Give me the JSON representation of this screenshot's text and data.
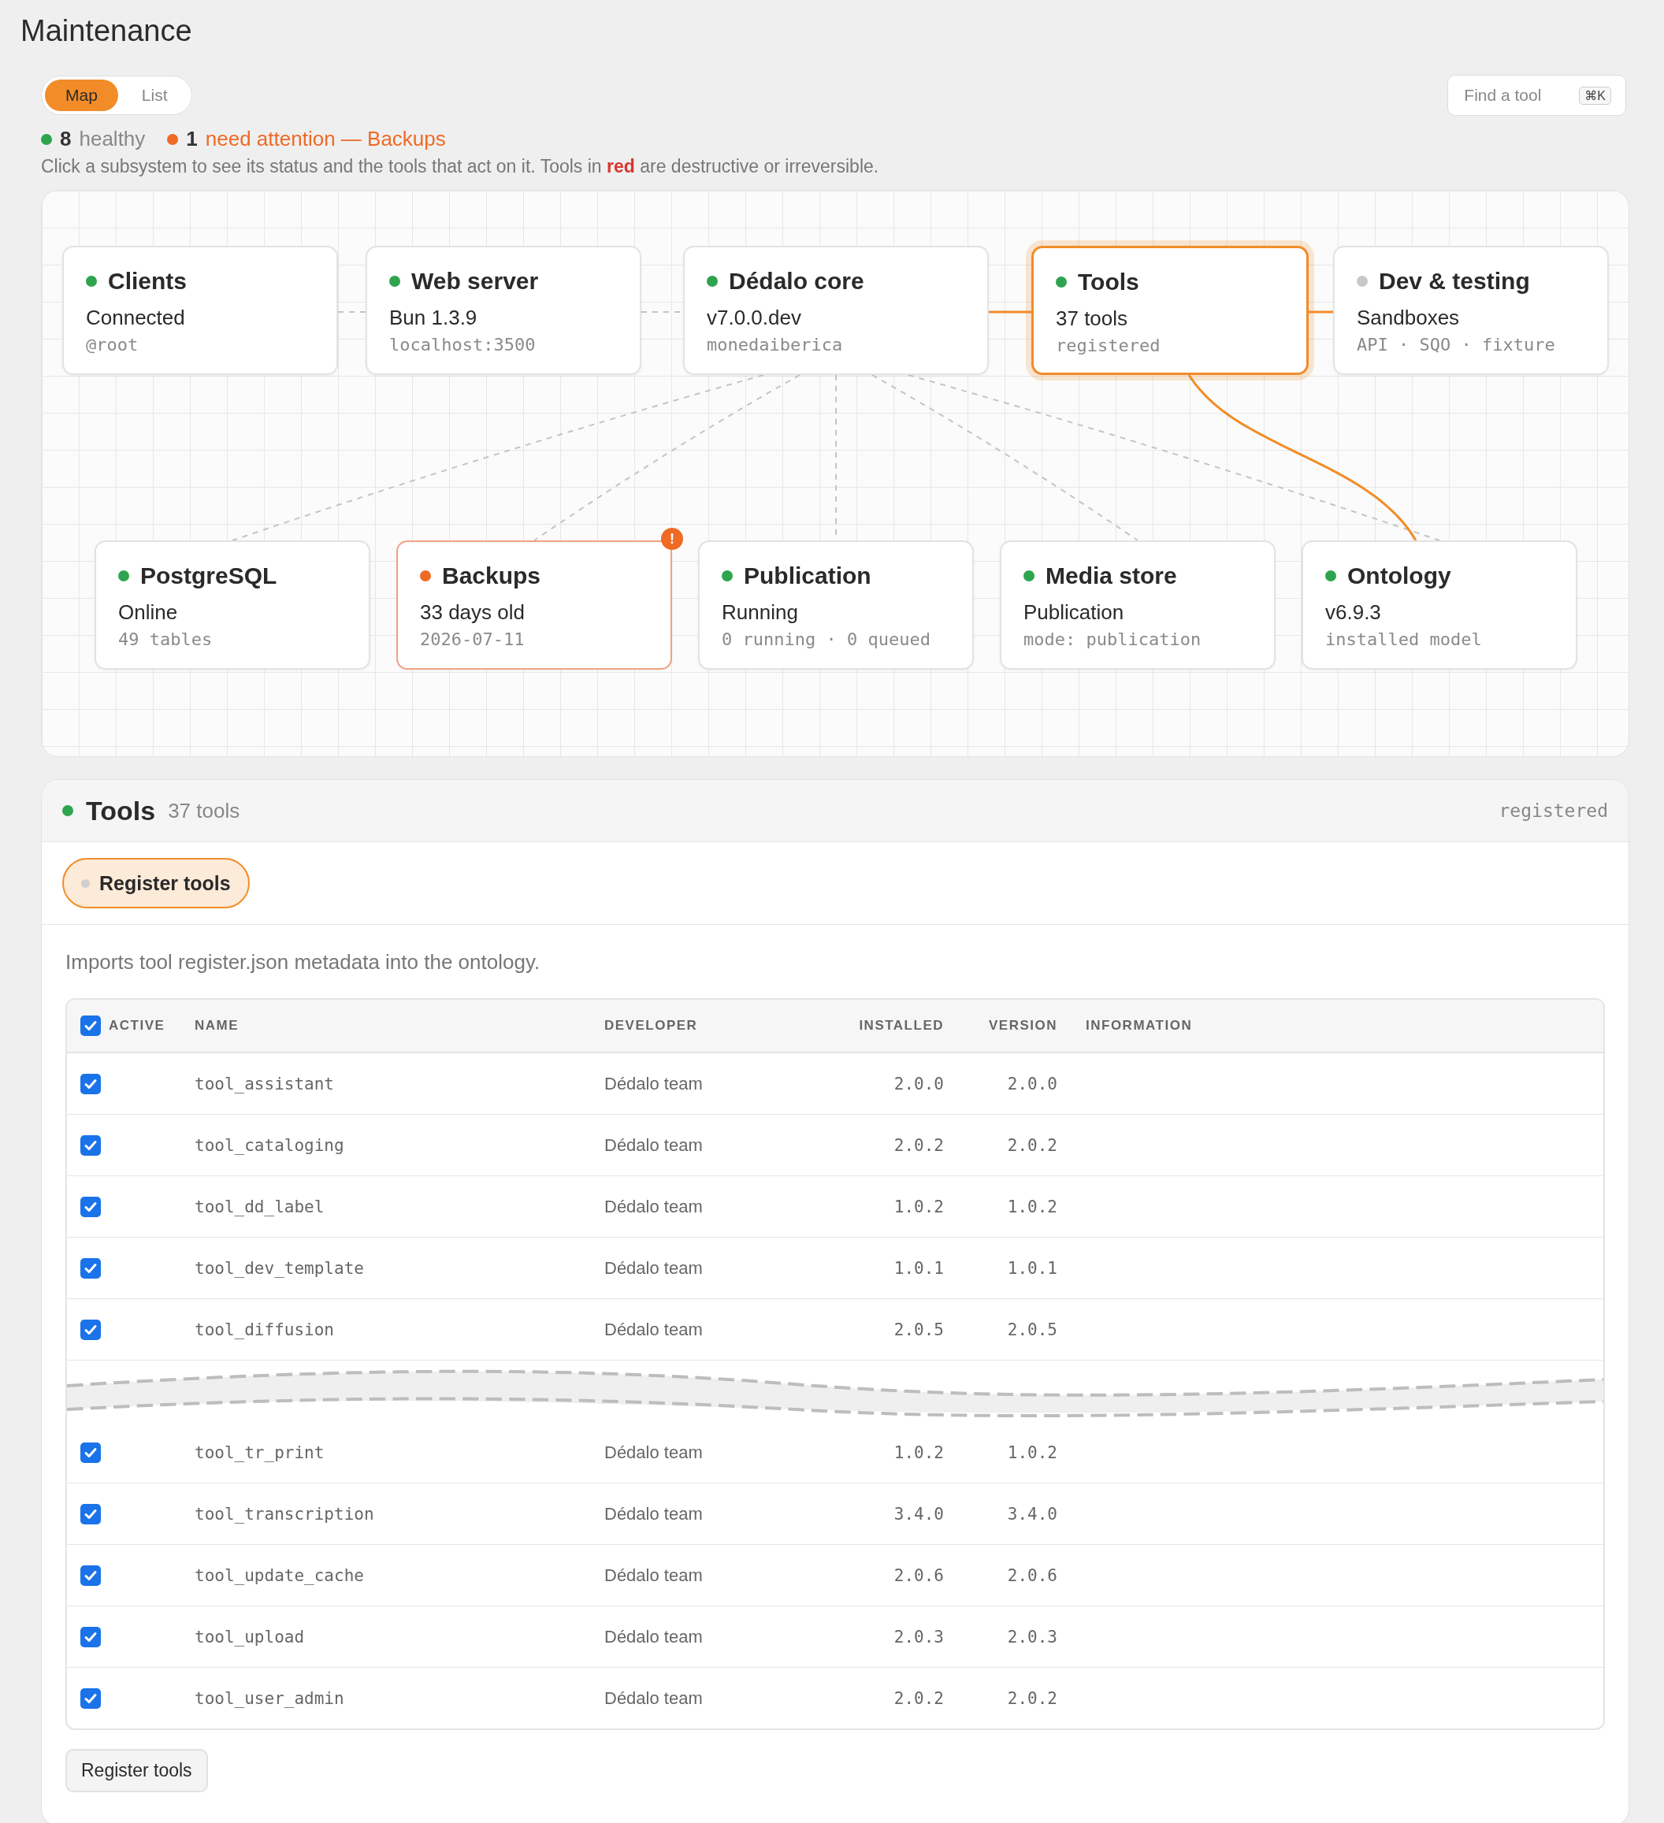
{
  "page": {
    "title": "Maintenance"
  },
  "view_tabs": [
    {
      "label": "Map",
      "selected": true
    },
    {
      "label": "List",
      "selected": false
    }
  ],
  "search": {
    "placeholder": "Find a tool",
    "shortcut": "⌘K"
  },
  "summary": {
    "healthy_count": "8",
    "healthy_label": "healthy",
    "attention_count": "1",
    "attention_label": "need attention — Backups",
    "description": "Click a subsystem to see its status and the tools that act on it. Tools in **red** are destructive or irreversible."
  },
  "map": {
    "nodes": [
      {
        "title": "Clients",
        "color": "#2ea44f",
        "value": "Connected",
        "detail": "@root",
        "selected": false
      },
      {
        "title": "Web server",
        "color": "#2ea44f",
        "value": "Bun 1.3.9",
        "detail": "localhost:3500",
        "selected": false
      },
      {
        "title": "Dédalo core",
        "color": "#2ea44f",
        "value": "v7.0.0.dev",
        "detail": "monedaiberica",
        "selected": false
      },
      {
        "title": "Tools",
        "color": "#2ea44f",
        "value": "37 tools",
        "detail": "registered",
        "selected": true
      },
      {
        "title": "Dev & testing",
        "color": "#c8c8c8",
        "value": "Sandboxes",
        "detail": "API · SQO · fixture",
        "selected": false
      },
      {
        "title": "PostgreSQL",
        "color": "#2ea44f",
        "value": "Online",
        "detail": "49 tables",
        "selected": false
      },
      {
        "title": "Backups",
        "color": "#ef6a25",
        "kind": "alert",
        "value": "33 days old",
        "detail": "2026-07-11",
        "badge": "!",
        "selected": false
      },
      {
        "title": "Publication",
        "color": "#2ea44f",
        "value": "Running",
        "detail": "0 running · 0 queued",
        "selected": false
      },
      {
        "title": "Media store",
        "color": "#2ea44f",
        "value": "Publication",
        "detail": "mode: publication",
        "selected": false
      },
      {
        "title": "Ontology",
        "color": "#2ea44f",
        "value": "v6.9.3",
        "detail": "installed model",
        "selected": false
      }
    ]
  },
  "detail": {
    "color": "#2ea44f",
    "title": "Tools",
    "count": "37 tools",
    "state": "registered",
    "actions": [
      {
        "label": "Register tools",
        "selected": true
      }
    ],
    "description": "Imports tool register.json metadata into the ontology.",
    "table": {
      "all_checked": true,
      "columns": [
        "ACTIVE",
        "NAME",
        "DEVELOPER",
        "INSTALLED",
        "VERSION",
        "INFORMATION"
      ],
      "row_groups": [
        [
          {
            "checked": true,
            "name": "tool_assistant",
            "developer": "Dédalo team",
            "installed": "2.0.0",
            "version": "2.0.0"
          },
          {
            "checked": true,
            "name": "tool_cataloging",
            "developer": "Dédalo team",
            "installed": "2.0.2",
            "version": "2.0.2"
          },
          {
            "checked": true,
            "name": "tool_dd_label",
            "developer": "Dédalo team",
            "installed": "1.0.2",
            "version": "1.0.2"
          },
          {
            "checked": true,
            "name": "tool_dev_template",
            "developer": "Dédalo team",
            "installed": "1.0.1",
            "version": "1.0.1"
          },
          {
            "checked": true,
            "name": "tool_diffusion",
            "developer": "Dédalo team",
            "installed": "2.0.5",
            "version": "2.0.5"
          }
        ],
        [
          {
            "checked": true,
            "name": "tool_tr_print",
            "developer": "Dédalo team",
            "installed": "1.0.2",
            "version": "1.0.2"
          },
          {
            "checked": true,
            "name": "tool_transcription",
            "developer": "Dédalo team",
            "installed": "3.4.0",
            "version": "3.4.0"
          },
          {
            "checked": true,
            "name": "tool_update_cache",
            "developer": "Dédalo team",
            "installed": "2.0.6",
            "version": "2.0.6"
          },
          {
            "checked": true,
            "name": "tool_upload",
            "developer": "Dédalo team",
            "installed": "2.0.3",
            "version": "2.0.3"
          },
          {
            "checked": true,
            "name": "tool_user_admin",
            "developer": "Dédalo team",
            "installed": "2.0.2",
            "version": "2.0.2"
          }
        ]
      ]
    },
    "button": "Register tools"
  }
}
